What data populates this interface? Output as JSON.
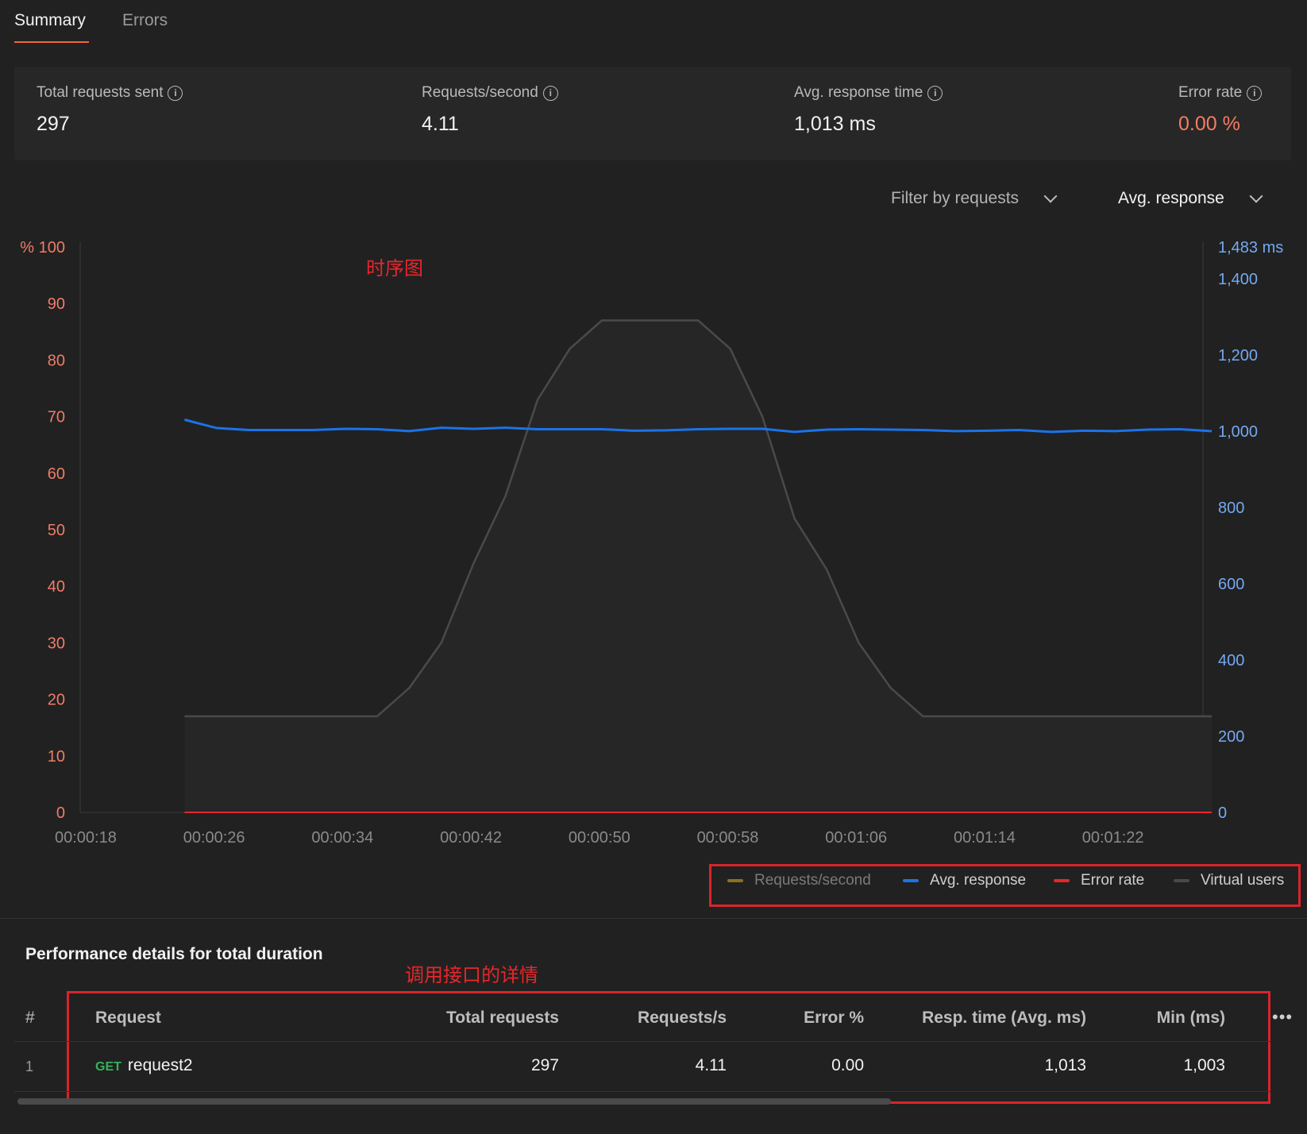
{
  "tabs": [
    {
      "label": "Summary"
    },
    {
      "label": "Errors"
    }
  ],
  "summary": {
    "total_requests": {
      "label": "Total requests sent",
      "value": "297"
    },
    "rps": {
      "label": "Requests/second",
      "value": "4.11"
    },
    "avg_response": {
      "label": "Avg. response time",
      "value": "1,013 ms"
    },
    "error_rate": {
      "label": "Error rate",
      "value": "0.00 %"
    }
  },
  "colors": {
    "error_value": "#f57c62",
    "left_axis": "#f07c68",
    "right_axis": "#74a9f2",
    "rps_series": "#8a7124",
    "avg_series": "#1a73e8",
    "error_series": "#e8262b",
    "vu_series": "#4a4a4a",
    "annotation": "#e8262b",
    "get_method": "#34b35b"
  },
  "filters": {
    "filter_requests": "Filter by requests",
    "metric_select": "Avg. response"
  },
  "annotations": {
    "chart": "时序图",
    "table": "调用接口的详情"
  },
  "chart_data": {
    "type": "line",
    "x_labels": [
      "00:00:18",
      "00:00:26",
      "00:00:34",
      "00:00:42",
      "00:00:50",
      "00:00:58",
      "00:01:06",
      "00:01:14",
      "00:01:22"
    ],
    "x_range": [
      18,
      88
    ],
    "left_axis": {
      "unit_label": "%",
      "ticks": [
        0,
        10,
        20,
        30,
        40,
        50,
        60,
        70,
        80,
        90,
        100
      ],
      "range": [
        0,
        100
      ]
    },
    "right_axis": {
      "unit_label": "ms",
      "ticks": [
        0,
        200,
        400,
        600,
        800,
        1000,
        1200,
        1400
      ],
      "max_label": "1,483 ms",
      "range": [
        0,
        1483
      ]
    },
    "series": [
      {
        "name": "Avg. response",
        "axis": "right",
        "x": [
          24.5,
          26.5,
          28.5,
          30.5,
          32.5,
          34.5,
          36.5,
          38.5,
          40.5,
          42.5,
          44.5,
          46.5,
          48.5,
          50.5,
          52.5,
          54.5,
          56.5,
          58.5,
          60.5,
          62.5,
          64.5,
          66.5,
          68.5,
          70.5,
          72.5,
          74.5,
          76.5,
          78.5,
          80.5,
          82.5,
          84.5,
          86.5,
          88.5
        ],
        "y": [
          1030,
          1008,
          1003,
          1003,
          1003,
          1006,
          1005,
          1000,
          1009,
          1006,
          1009,
          1005,
          1005,
          1005,
          1001,
          1002,
          1005,
          1006,
          1006,
          998,
          1004,
          1005,
          1004,
          1003,
          1000,
          1001,
          1003,
          998,
          1001,
          1000,
          1004,
          1005,
          1000
        ]
      },
      {
        "name": "Virtual users",
        "axis": "left",
        "x": [
          24.5,
          26.5,
          28.5,
          30.5,
          32.5,
          34.5,
          36.5,
          38.5,
          40.5,
          42.5,
          44.5,
          46.5,
          48.5,
          50.5,
          52.5,
          54.5,
          56.5,
          58.5,
          60.5,
          62.5,
          64.5,
          66.5,
          68.5,
          70.5,
          72.5,
          74.5,
          76.5,
          78.5,
          80.5,
          82.5,
          84.5,
          86.5,
          88.5
        ],
        "y": [
          17,
          17,
          17,
          17,
          17,
          17,
          17,
          22,
          30,
          44,
          56,
          73,
          82,
          87,
          87,
          87,
          87,
          82,
          70,
          52,
          43,
          30,
          22,
          17,
          17,
          17,
          17,
          17,
          17,
          17,
          17,
          17,
          17
        ]
      },
      {
        "name": "Error rate",
        "axis": "left",
        "x": [
          24.5,
          88.5
        ],
        "y": [
          0,
          0
        ]
      },
      {
        "name": "Requests/second",
        "axis": "left",
        "x": [],
        "y": []
      }
    ],
    "legend": [
      {
        "name": "Requests/second"
      },
      {
        "name": "Avg. response"
      },
      {
        "name": "Error rate"
      },
      {
        "name": "Virtual users"
      }
    ]
  },
  "performance": {
    "title": "Performance details for total duration",
    "columns": [
      "#",
      "Request",
      "Total requests",
      "Requests/s",
      "Error %",
      "Resp. time (Avg. ms)",
      "Min (ms)"
    ],
    "rows": [
      {
        "index": "1",
        "method": "GET",
        "name": "request2",
        "total": "297",
        "rps": "4.11",
        "error": "0.00",
        "avg": "1,013",
        "min": "1,003"
      }
    ],
    "more_label": "•••"
  }
}
